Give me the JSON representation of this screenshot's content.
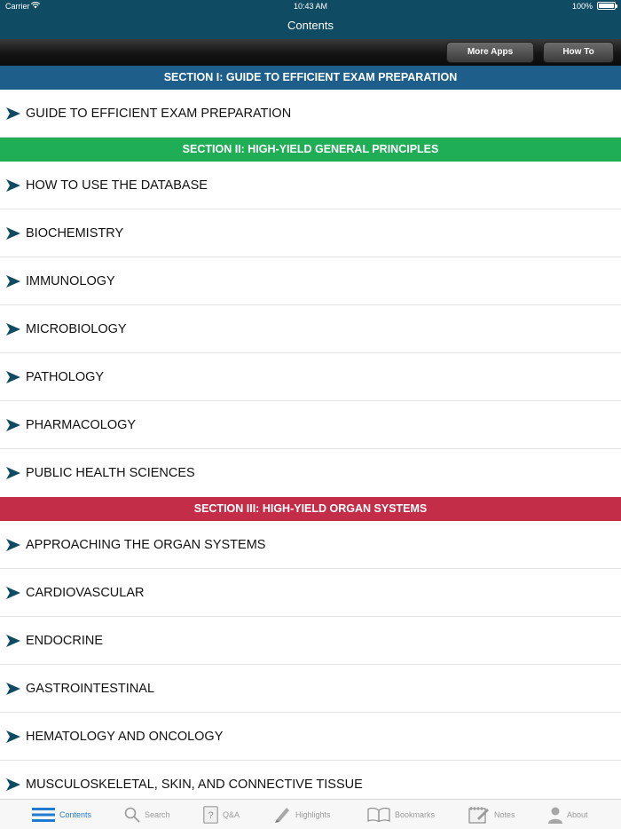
{
  "status_bar": {
    "carrier": "Carrier",
    "time": "10:43 AM",
    "battery": "100%"
  },
  "nav": {
    "title": "Contents"
  },
  "toolbar": {
    "more_apps": "More Apps",
    "how_to": "How To"
  },
  "colors": {
    "nav_bg": "#0f4b63",
    "section_1": "#1e5e8b",
    "section_2": "#1fae56",
    "section_3": "#c42d48",
    "arrow": "#0f4b63",
    "tab_active": "#1f7ad0",
    "tab_inactive": "#9a9a9a"
  },
  "sections": [
    {
      "title": "SECTION I: GUIDE TO EFFICIENT EXAM PREPARATION",
      "items": [
        "GUIDE TO EFFICIENT EXAM PREPARATION"
      ]
    },
    {
      "title": "SECTION II: HIGH-YIELD GENERAL PRINCIPLES",
      "items": [
        "HOW TO USE THE DATABASE",
        "BIOCHEMISTRY",
        "IMMUNOLOGY",
        "MICROBIOLOGY",
        "PATHOLOGY",
        "PHARMACOLOGY",
        "PUBLIC HEALTH SCIENCES"
      ]
    },
    {
      "title": "SECTION III: HIGH-YIELD ORGAN SYSTEMS",
      "items": [
        "APPROACHING THE ORGAN SYSTEMS",
        "CARDIOVASCULAR",
        "ENDOCRINE",
        "GASTROINTESTINAL",
        "HEMATOLOGY AND ONCOLOGY",
        "MUSCULOSKELETAL, SKIN, AND CONNECTIVE TISSUE"
      ]
    }
  ],
  "tabs": [
    {
      "label": "Contents",
      "icon": "list-icon",
      "active": true
    },
    {
      "label": "Search",
      "icon": "search-icon",
      "active": false
    },
    {
      "label": "Q&A",
      "icon": "question-icon",
      "active": false
    },
    {
      "label": "Highlights",
      "icon": "highlighter-icon",
      "active": false
    },
    {
      "label": "Bookmarks",
      "icon": "book-icon",
      "active": false
    },
    {
      "label": "Notes",
      "icon": "notepad-icon",
      "active": false
    },
    {
      "label": "About",
      "icon": "person-icon",
      "active": false
    }
  ]
}
